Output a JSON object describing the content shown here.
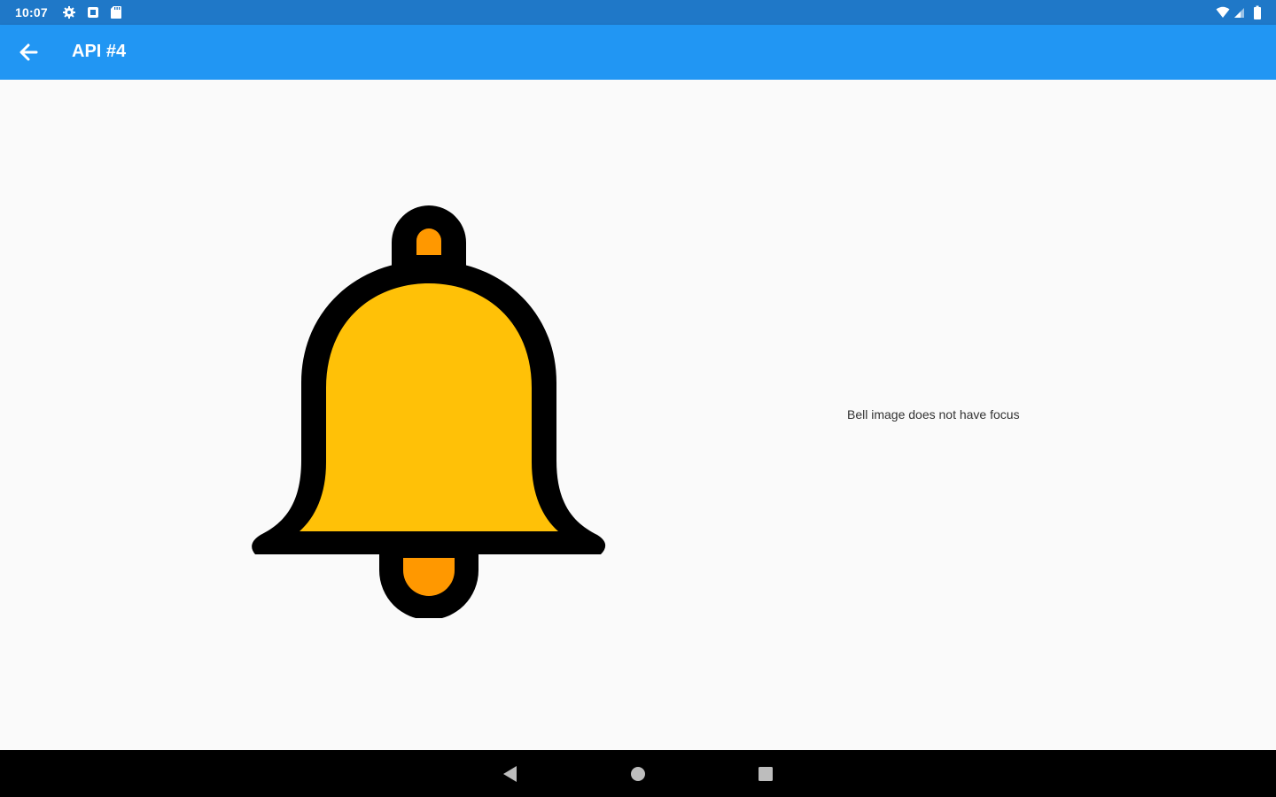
{
  "status_bar": {
    "time": "10:07",
    "icons": [
      "settings-icon",
      "sim-icon",
      "sd-card-icon",
      "wifi-icon",
      "signal-icon",
      "battery-icon"
    ]
  },
  "app_bar": {
    "title": "API #4",
    "back_icon": "arrow-back-icon",
    "color": "#2196f3"
  },
  "main": {
    "image_icon": "bell-icon",
    "status_text": "Bell image does not have focus",
    "bell_colors": {
      "body": "#ffc107",
      "accent": "#ff9800",
      "outline": "#000000"
    }
  },
  "nav_bar": {
    "buttons": [
      "back-triangle-icon",
      "home-circle-icon",
      "recents-square-icon"
    ]
  }
}
